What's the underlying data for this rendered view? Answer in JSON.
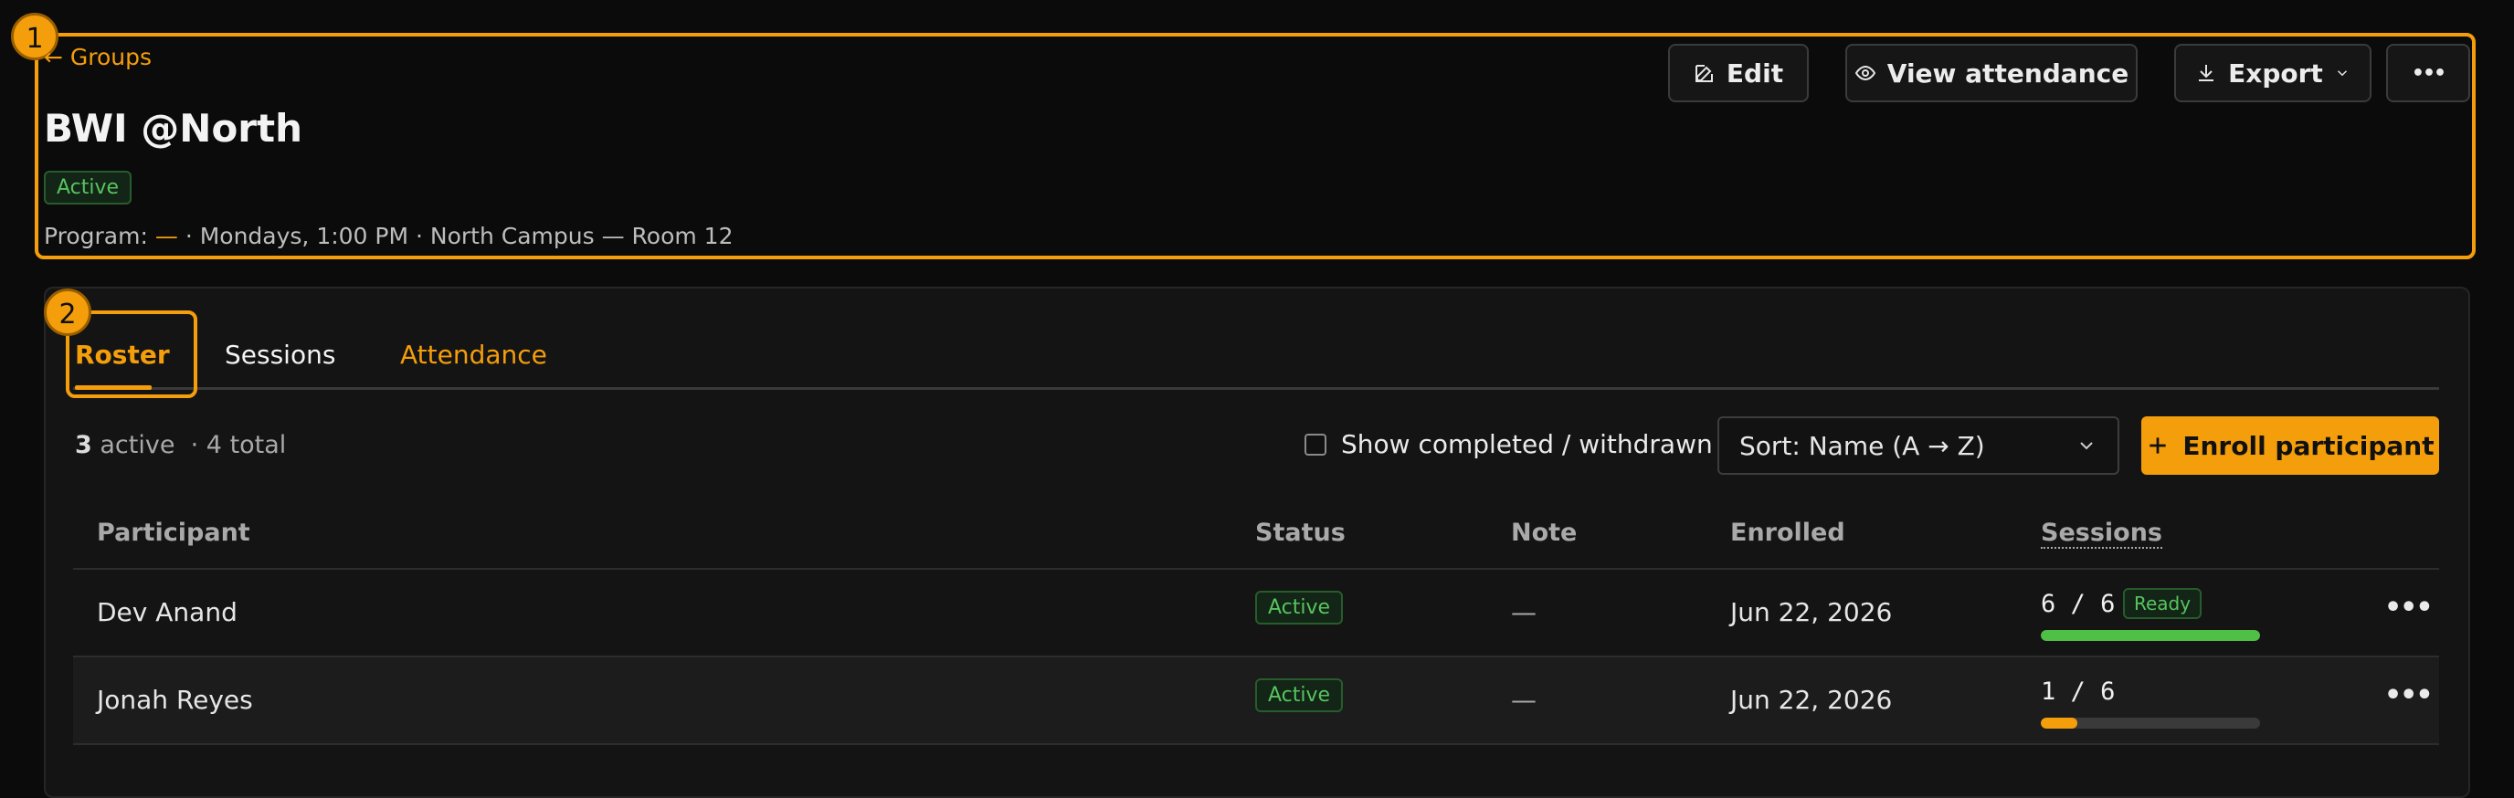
{
  "markers": {
    "header": "1",
    "tabs": "2"
  },
  "header": {
    "back_label": "← Groups",
    "title": "BWI @North",
    "status": "Active",
    "meta_prefix": "Program:",
    "meta_program": "—",
    "meta_rest": "· Mondays, 1:00 PM · North Campus — Room 12"
  },
  "actions": {
    "edit": "Edit",
    "view_attendance": "View attendance",
    "export": "Export",
    "more": "•••"
  },
  "tabs": [
    {
      "label": "Roster",
      "active": true
    },
    {
      "label": "Sessions",
      "active": false
    },
    {
      "label": "Attendance",
      "active": false
    }
  ],
  "toolbar": {
    "active_count": "3",
    "active_label": "active",
    "total_label": "· 4 total",
    "show_completed_label": "Show completed / withdrawn",
    "show_completed_checked": false,
    "sort_value": "Sort: Name (A → Z)",
    "enroll_label": "Enroll participant"
  },
  "table": {
    "columns": [
      "Participant",
      "Status",
      "Note",
      "Enrolled",
      "Sessions"
    ],
    "rows": [
      {
        "name": "Dev Anand",
        "status": "Active",
        "note": "—",
        "enrolled": "Jun 22, 2026",
        "sessions_done": "6",
        "sessions_sep": "/",
        "sessions_total": "6",
        "sessions_badge": "Ready",
        "progress": 1.0,
        "progress_color": "#4fbf45",
        "more": "•••"
      },
      {
        "name": "Jonah Reyes",
        "status": "Active",
        "note": "—",
        "enrolled": "Jun 22, 2026",
        "sessions_done": "1",
        "sessions_sep": "/",
        "sessions_total": "6",
        "sessions_badge": "",
        "progress": 0.1667,
        "progress_color": "#f59e0b",
        "more": "•••"
      }
    ]
  },
  "colors": {
    "accent": "#f59e0b",
    "success": "#57c35f",
    "background": "#0b0b0b"
  }
}
